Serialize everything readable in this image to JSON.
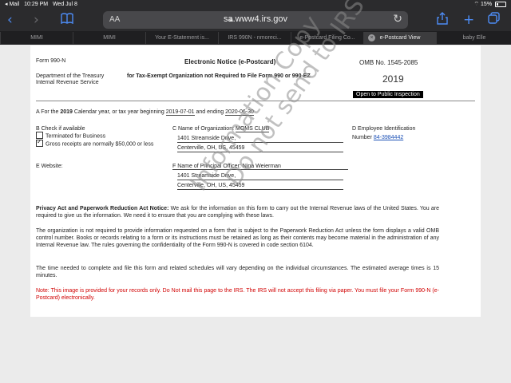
{
  "status_bar": {
    "carrier": "◂ Mail",
    "time": "10:29 PM",
    "date": "Wed Jul 8",
    "battery": "15%"
  },
  "toolbar": {
    "text_size": "AA",
    "url": "sa.www4.irs.gov"
  },
  "tabs": [
    {
      "label": "MIMI"
    },
    {
      "label": "MIMI"
    },
    {
      "label": "Your E-Statement is..."
    },
    {
      "label": "IRS 990N - nmoreci..."
    },
    {
      "label": "e-Postcard Filing Co..."
    },
    {
      "label": "e-Postcard View",
      "active": true
    },
    {
      "label": "baby Elle"
    }
  ],
  "form": {
    "form_label": "Form 990-N",
    "dept_line1": "Department of the Treasury",
    "dept_line2": "Internal Revenue Service",
    "title": "Electronic Notice (e-Postcard)",
    "subtitle": "for Tax-Exempt Organization not Required to File Form 990 or 990-EZ",
    "omb": "OMB No. 1545-2085",
    "year": "2019",
    "public_badge": "Open to Public Inspection",
    "section_a_prefix": "A For the",
    "section_a_year": "2019",
    "section_a_mid": "Calendar year, or tax year beginning",
    "begin_date": "2019-07-01",
    "section_a_and": "and ending",
    "end_date": "2020-06-30",
    "b_label": "B Check if available",
    "b_option1": "Terminated for Business",
    "b_option2": "Gross receipts are normally $50,000 or less",
    "c_label": "C Name of Organization:",
    "org_name": "MOMS CLUB",
    "org_address1": "1401 Streamside Drive,",
    "org_address2": "Centerville, OH, US, 45459",
    "d_label": "D Employee Identification",
    "d_label2": "Number",
    "ein": "84-3984442",
    "e_label": "E Website:",
    "f_label": "F Name of Principal Officer:",
    "officer_name": "Nina Weierman",
    "officer_address1": "1401 Streamside Drive,",
    "officer_address2": "Centerville, OH, US, 45459",
    "privacy_heading": "Privacy Act and Paperwork Reduction Act Notice:",
    "privacy_text": "We ask for the information on this form to carry out the Internal Revenue laws of the United States. You are required to give us the information. We need it to ensure that you are complying with these laws.",
    "omb_text": "The organization is not required to provide information requested on a form that is subject to the Paperwork Reduction Act unless the form displays a valid OMB control number. Books or records relating to a form or its instructions must be retained as long as their contents may become material in the administration of any Internal Revenue law. The rules governing the confidentiality of the Form 990-N is covered in code section 6104.",
    "time_text": "The time needed to complete and file this form and related schedules will vary depending on the individual circumstances. The estimated average times is 15 minutes.",
    "note_text": "Note: This image is provided for your records only. Do Not mail this page to the IRS. The IRS will not accept this filing via paper. You must file your Form 990-N (e-Postcard) electronically.",
    "watermark1": "Information Copy",
    "watermark2": "Do not send to IRS"
  }
}
